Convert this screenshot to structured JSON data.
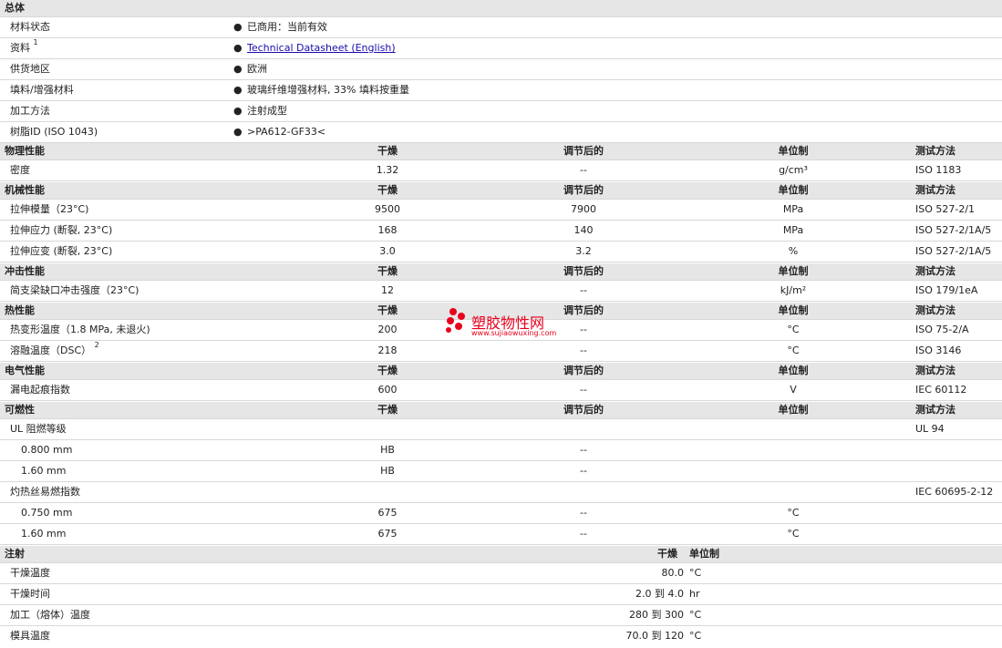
{
  "general": {
    "title": "总体",
    "rows": [
      {
        "label": "材料状态",
        "value": "已商用：当前有效"
      },
      {
        "label": "资料",
        "note": "1",
        "value": "Technical Datasheet (English)"
      },
      {
        "label": "供货地区",
        "value": "欧洲"
      },
      {
        "label": "填料/增强材料",
        "value": "玻璃纤维增强材料, 33% 填料按重量"
      },
      {
        "label": "加工方法",
        "value": "注射成型"
      },
      {
        "label": "树脂ID (ISO 1043)",
        "value": ">PA612-GF33<"
      }
    ]
  },
  "columns": {
    "dry": "干燥",
    "conditioned": "调节后的",
    "unit": "单位制",
    "method": "测试方法"
  },
  "physical": {
    "title": "物理性能",
    "rows": [
      {
        "label": "密度",
        "dry": "1.32",
        "cond": "--",
        "unit": "g/cm³",
        "method": "ISO 1183"
      }
    ]
  },
  "mechanical": {
    "title": "机械性能",
    "rows": [
      {
        "label": "拉伸模量（23°C)",
        "dry": "9500",
        "cond": "7900",
        "unit": "MPa",
        "method": "ISO 527-2/1"
      },
      {
        "label": "拉伸应力 (断裂, 23°C)",
        "dry": "168",
        "cond": "140",
        "unit": "MPa",
        "method": "ISO 527-2/1A/5"
      },
      {
        "label": "拉伸应变 (断裂, 23°C)",
        "dry": "3.0",
        "cond": "3.2",
        "unit": "%",
        "method": "ISO 527-2/1A/5"
      }
    ]
  },
  "impact": {
    "title": "冲击性能",
    "rows": [
      {
        "label": "简支梁缺口冲击强度（23°C)",
        "dry": "12",
        "cond": "--",
        "unit": "kJ/m²",
        "method": "ISO 179/1eA"
      }
    ]
  },
  "thermal": {
    "title": "热性能",
    "rows": [
      {
        "label": "热变形温度（1.8 MPa, 未退火)",
        "dry": "200",
        "cond": "--",
        "unit": "°C",
        "method": "ISO 75-2/A"
      },
      {
        "label": "溶融温度（DSC）",
        "note": "2",
        "dry": "218",
        "cond": "--",
        "unit": "°C",
        "method": "ISO 3146"
      }
    ]
  },
  "electrical": {
    "title": "电气性能",
    "rows": [
      {
        "label": "漏电起痕指数",
        "dry": "600",
        "cond": "--",
        "unit": "V",
        "method": "IEC 60112"
      }
    ]
  },
  "flammability": {
    "title": "可燃性",
    "rows": [
      {
        "label": "UL 阻燃等级",
        "dry": "",
        "cond": "",
        "unit": "",
        "method": "UL 94"
      },
      {
        "label": "0.800 mm",
        "dry": "HB",
        "cond": "--",
        "unit": "",
        "method": ""
      },
      {
        "label": "1.60 mm",
        "dry": "HB",
        "cond": "--",
        "unit": "",
        "method": ""
      },
      {
        "label": "灼热丝易燃指数",
        "dry": "",
        "cond": "",
        "unit": "",
        "method": "IEC 60695-2-12"
      },
      {
        "label": "0.750 mm",
        "dry": "675",
        "cond": "--",
        "unit": "°C",
        "method": ""
      },
      {
        "label": "1.60 mm",
        "dry": "675",
        "cond": "--",
        "unit": "°C",
        "method": ""
      }
    ]
  },
  "injection": {
    "title": "注射",
    "dry": "干燥",
    "unit": "单位制",
    "rows": [
      {
        "label": "干燥温度",
        "value": "80.0",
        "unit": "°C"
      },
      {
        "label": "干燥时间",
        "value": "2.0 到 4.0",
        "unit": "hr"
      },
      {
        "label": "加工（熔体）温度",
        "value": "280 到 300",
        "unit": "°C"
      },
      {
        "label": "模具温度",
        "value": "70.0 到 120",
        "unit": "°C"
      }
    ]
  },
  "watermark": {
    "text": "塑胶物性网",
    "url": "www.sujiaowuxing.com",
    "color": "#e8001c"
  }
}
